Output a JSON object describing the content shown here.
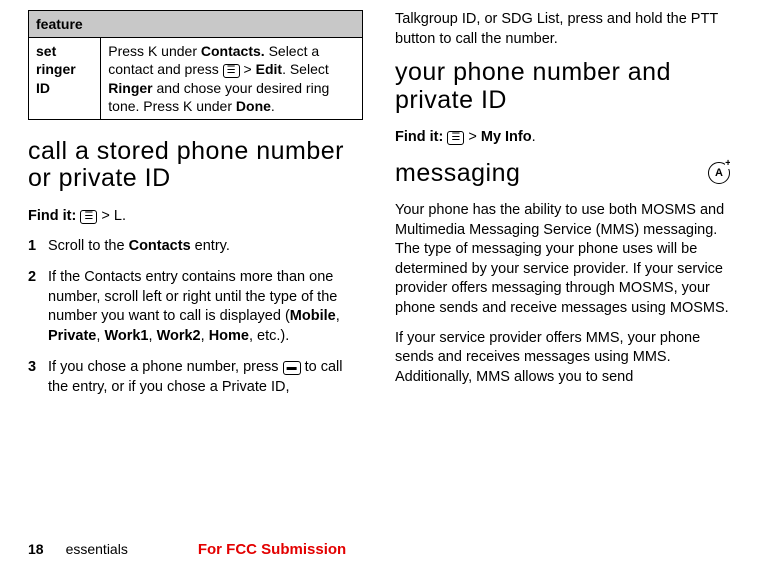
{
  "table": {
    "header": "feature",
    "row_label": "set ringer ID",
    "row_body_parts": {
      "p1a": "Press ",
      "k": "K",
      "p1b": " under ",
      "contacts": "Contacts.",
      "p2a": " Select a contact and press ",
      "iconMenu": "☰",
      "gt": " > ",
      "edit": "Edit",
      "p2b": ". Select ",
      "ringer": "Ringer",
      "p2c": " and chose your desired ring tone. Press ",
      "k2": "K",
      "p2d": " under ",
      "done": "Done",
      "p2e": "."
    }
  },
  "left": {
    "heading": "call a stored phone number or private ID",
    "find_it_label": "Find it:",
    "find_it_icon": "☰",
    "find_it_gt": " > ",
    "find_it_path": "L",
    "find_it_end": ".",
    "steps": [
      {
        "num": "1",
        "parts": {
          "a": "Scroll to the ",
          "b": "Contacts",
          "c": " entry."
        }
      },
      {
        "num": "2",
        "parts": {
          "a": "If the Contacts entry contains more than one number, scroll left or right until the type of the number you want to call is displayed (",
          "m": "Mobile",
          "s1": ", ",
          "p": "Private",
          "s2": ", ",
          "w1": "Work1",
          "s3": ", ",
          "w2": "Work2",
          "s4": ", ",
          "h": "Home",
          "c": ", etc.)."
        }
      },
      {
        "num": "3",
        "parts": {
          "a": "If you chose a phone number, press ",
          "btn": "▬",
          "b": " to call the entry, or if you chose a Private ID,"
        }
      }
    ]
  },
  "right": {
    "top_para": "Talkgroup ID, or SDG List, press and hold the PTT button to call the number.",
    "heading1": "your phone number and private ID",
    "find_it_label": "Find it:",
    "find_it_icon": "☰",
    "find_it_gt": " > ",
    "find_it_path": "My Info",
    "find_it_end": ".",
    "heading2": "messaging",
    "circle_label": "A",
    "para1": "Your phone has the ability to use both MOSMS and Multimedia Messaging Service (MMS) messaging. The type of messaging your phone uses will be determined by your service provider. If your service provider offers messaging through MOSMS, your phone sends and receive messages using MOSMS.",
    "para2": "If your service provider offers MMS, your phone sends and receives messages using MMS. Additionally, MMS allows you to send"
  },
  "footer": {
    "page": "18",
    "label": "essentials",
    "fcc": "For FCC Submission"
  }
}
